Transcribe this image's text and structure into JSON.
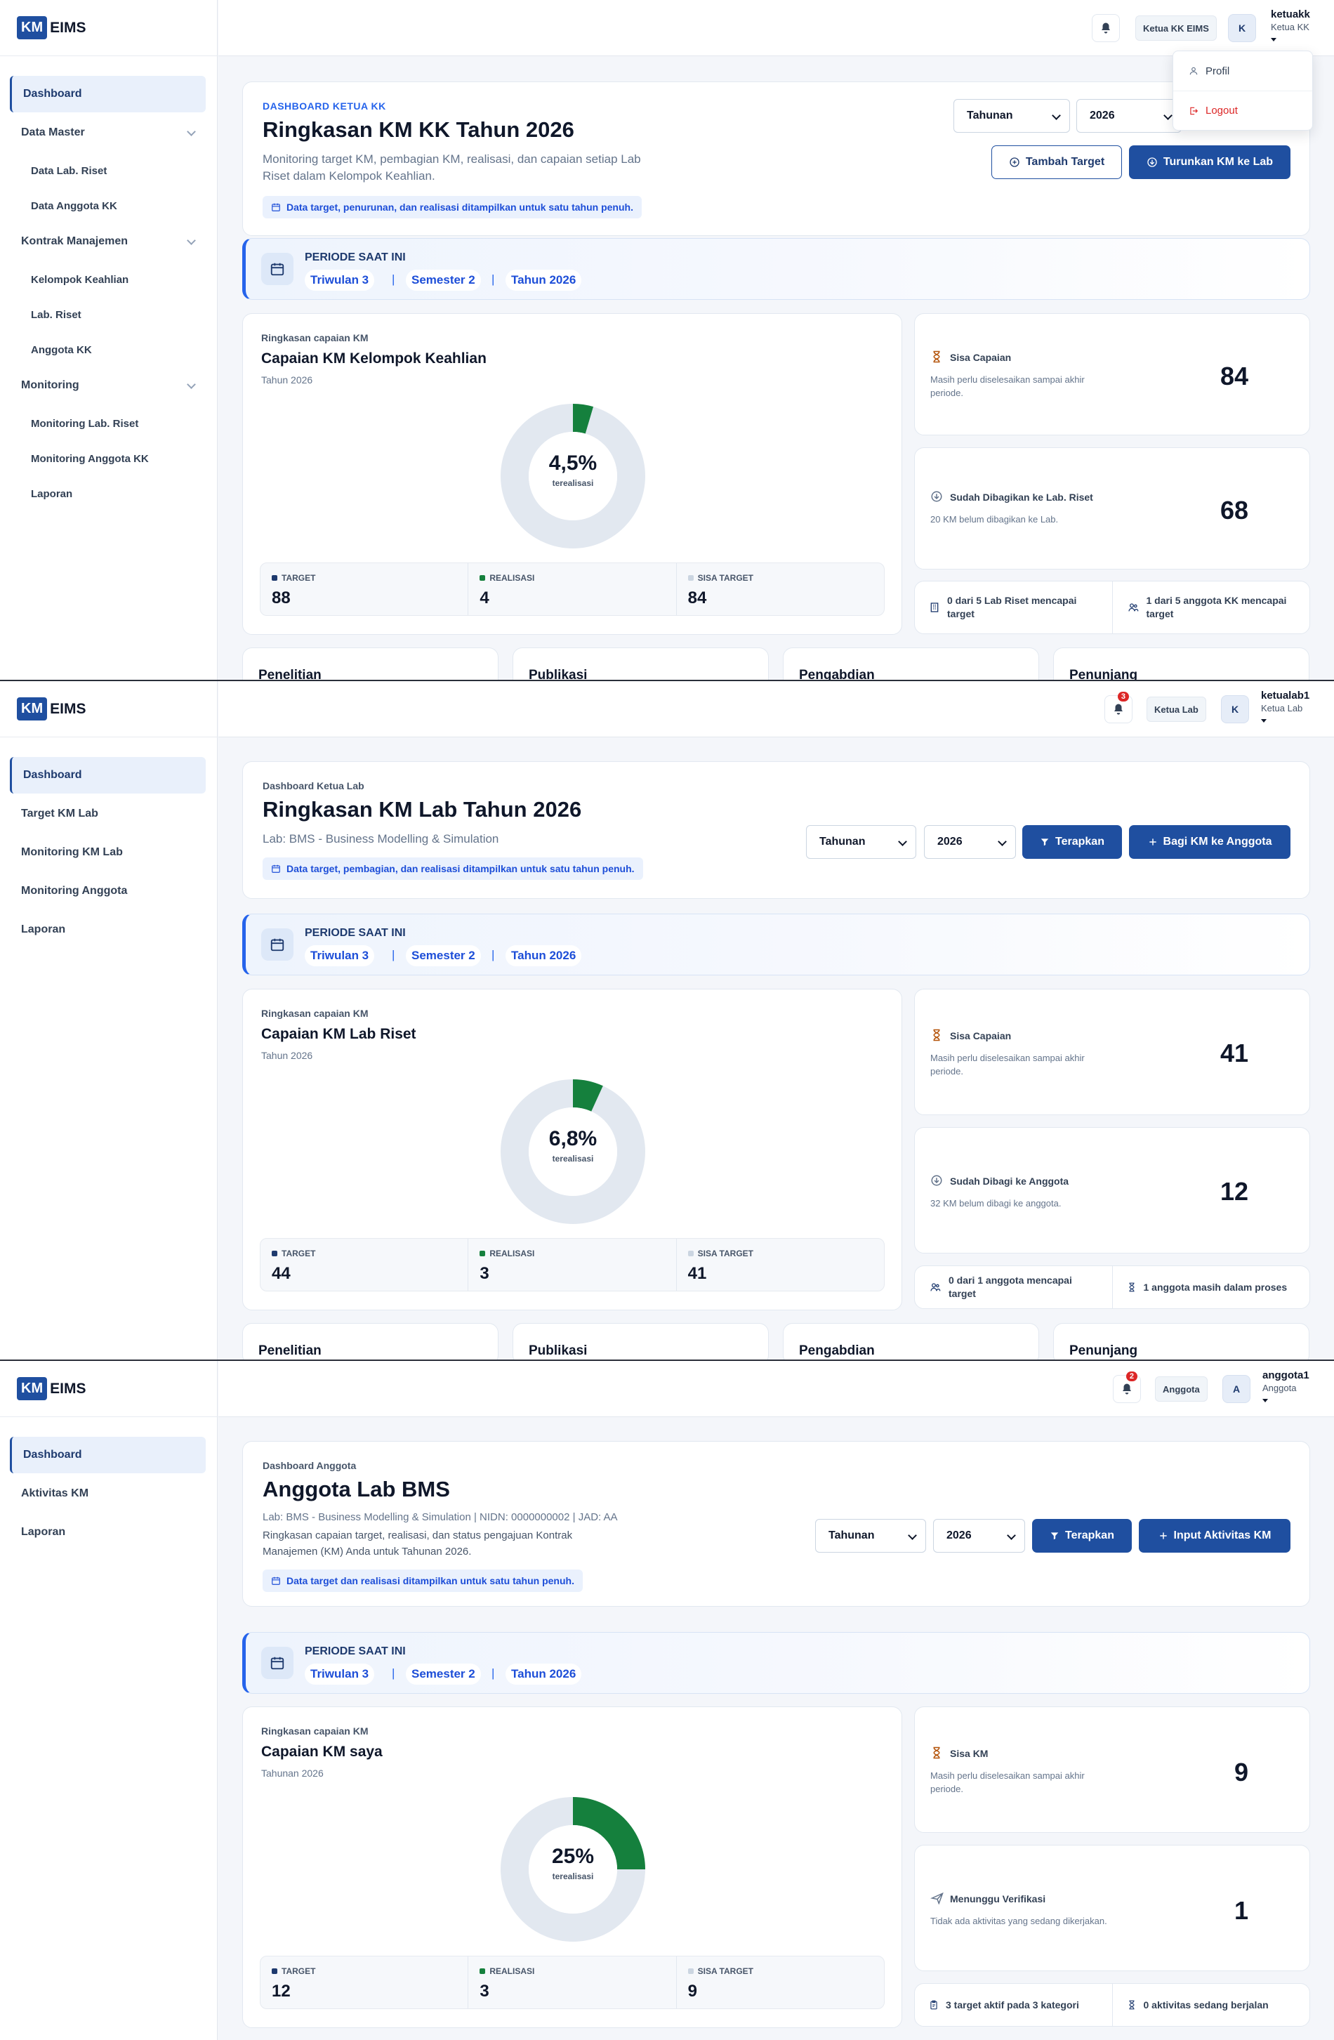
{
  "brand": {
    "km": "KM",
    "name": "EIMS"
  },
  "colors": {
    "primary": "#1f4fa0",
    "accent_blue": "#2563eb",
    "progress_green": "#15803d",
    "track": "#e2e8f0",
    "danger": "#dc2626"
  },
  "icons": {
    "bell": "bell-icon",
    "hourglass": "hourglass-icon",
    "download": "download-circle-icon",
    "calendar": "calendar-icon",
    "users": "users-icon",
    "building": "building-icon",
    "plane": "paper-plane-icon",
    "clipboard": "clipboard-icon",
    "filter": "filter-icon",
    "plus": "plus-icon",
    "profile": "user-icon",
    "logout": "logout-icon"
  },
  "panels": [
    {
      "sidebar": {
        "items": [
          {
            "label": "Dashboard",
            "active": true,
            "type": "item"
          },
          {
            "label": "Data Master",
            "type": "group"
          },
          {
            "label": "Data Lab. Riset",
            "type": "sub"
          },
          {
            "label": "Data Anggota KK",
            "type": "sub"
          },
          {
            "label": "Kontrak Manajemen",
            "type": "group"
          },
          {
            "label": "Kelompok Keahlian",
            "type": "sub"
          },
          {
            "label": "Lab. Riset",
            "type": "sub"
          },
          {
            "label": "Anggota KK",
            "type": "sub"
          },
          {
            "label": "Monitoring",
            "type": "group"
          },
          {
            "label": "Monitoring Lab. Riset",
            "type": "sub"
          },
          {
            "label": "Monitoring Anggota KK",
            "type": "sub"
          },
          {
            "label": "Laporan",
            "type": "sub"
          }
        ]
      },
      "topbar": {
        "badge": "",
        "role_chip": "Ketua KK EIMS",
        "avatar": "K",
        "user": "ketuakk",
        "user_role": "Ketua KK"
      },
      "dropdown": {
        "profile": "Profil",
        "logout": "Logout"
      },
      "header": {
        "eyebrow": "DASHBOARD KETUA KK",
        "title": "Ringkasan KM KK Tahun 2026",
        "desc": "Monitoring target KM, pembagian KM, realisasi, dan capaian setiap Lab Riset dalam Kelompok Keahlian.",
        "note": "Data target, penurunan, dan realisasi ditampilkan untuk satu tahun penuh.",
        "select_period": "Tahunan",
        "select_year": "2026",
        "btn_secondary": "Tambah Target",
        "btn_primary": "Turunkan KM ke Lab"
      },
      "period": {
        "label": "PERIODE SAAT INI",
        "triwulan": "Triwulan 3",
        "semester": "Semester 2",
        "tahun": "Tahun 2026"
      },
      "chart": {
        "eyebrow": "Ringkasan capaian KM",
        "title": "Capaian KM Kelompok Keahlian",
        "sub": "Tahun 2026",
        "pct": "4,5%",
        "cap": "terealisasi",
        "target_lbl": "TARGET",
        "target": "88",
        "real_lbl": "REALISASI",
        "real": "4",
        "sisa_lbl": "SISA TARGET",
        "sisa": "84"
      },
      "chart_data": {
        "type": "pie",
        "categories": [
          "Realisasi",
          "Sisa Target"
        ],
        "values": [
          4,
          84
        ],
        "percent_realized": 4.5
      },
      "side1": {
        "title": "Sisa Capaian",
        "desc": "Masih perlu diselesaikan sampai akhir periode.",
        "value": "84"
      },
      "side2": {
        "title": "Sudah Dibagikan ke Lab. Riset",
        "desc": "20 KM belum dibagikan ke Lab.",
        "value": "68"
      },
      "mini": [
        "0 dari 5 Lab Riset mencapai target",
        "1 dari 5 anggota KK mencapai target"
      ],
      "categories": [
        "Penelitian",
        "Publikasi",
        "Pengabdian",
        "Penunjang"
      ]
    },
    {
      "sidebar": {
        "items": [
          {
            "label": "Dashboard",
            "active": true,
            "type": "item"
          },
          {
            "label": "Target KM Lab",
            "type": "item"
          },
          {
            "label": "Monitoring KM Lab",
            "type": "item"
          },
          {
            "label": "Monitoring Anggota",
            "type": "item"
          },
          {
            "label": "Laporan",
            "type": "item"
          }
        ]
      },
      "topbar": {
        "badge": "3",
        "role_chip": "Ketua Lab",
        "avatar": "K",
        "user": "ketualab1",
        "user_role": "Ketua Lab"
      },
      "header": {
        "eyebrow": "Dashboard Ketua Lab",
        "title": "Ringkasan KM Lab Tahun 2026",
        "desc": "Lab: BMS - Business Modelling & Simulation",
        "note": "Data target, pembagian, dan realisasi ditampilkan untuk satu tahun penuh.",
        "select_period": "Tahunan",
        "select_year": "2026",
        "btn_filter": "Terapkan",
        "btn_primary": "Bagi KM ke Anggota"
      },
      "period": {
        "label": "PERIODE SAAT INI",
        "triwulan": "Triwulan 3",
        "semester": "Semester 2",
        "tahun": "Tahun 2026"
      },
      "chart": {
        "eyebrow": "Ringkasan capaian KM",
        "title": "Capaian KM Lab Riset",
        "sub": "Tahun 2026",
        "pct": "6,8%",
        "cap": "terealisasi",
        "target_lbl": "TARGET",
        "target": "44",
        "real_lbl": "REALISASI",
        "real": "3",
        "sisa_lbl": "SISA TARGET",
        "sisa": "41"
      },
      "chart_data": {
        "type": "pie",
        "categories": [
          "Realisasi",
          "Sisa Target"
        ],
        "values": [
          3,
          41
        ],
        "percent_realized": 6.8
      },
      "side1": {
        "title": "Sisa Capaian",
        "desc": "Masih perlu diselesaikan sampai akhir periode.",
        "value": "41"
      },
      "side2": {
        "title": "Sudah Dibagi ke Anggota",
        "desc": "32 KM belum dibagi ke anggota.",
        "value": "12"
      },
      "mini": [
        "0 dari 1 anggota mencapai target",
        "1 anggota masih dalam proses"
      ],
      "categories": [
        "Penelitian",
        "Publikasi",
        "Pengabdian",
        "Penunjang"
      ]
    },
    {
      "sidebar": {
        "items": [
          {
            "label": "Dashboard",
            "active": true,
            "type": "item"
          },
          {
            "label": "Aktivitas KM",
            "type": "item"
          },
          {
            "label": "Laporan",
            "type": "item"
          }
        ]
      },
      "topbar": {
        "badge": "2",
        "role_chip": "Anggota",
        "avatar": "A",
        "user": "anggota1",
        "user_role": "Anggota"
      },
      "header": {
        "eyebrow": "Dashboard Anggota",
        "title": "Anggota Lab BMS",
        "meta": "Lab: BMS - Business Modelling & Simulation | NIDN: 0000000002 | JAD: AA",
        "desc": "Ringkasan capaian target, realisasi, dan status pengajuan Kontrak Manajemen (KM) Anda untuk Tahunan 2026.",
        "note": "Data target dan realisasi ditampilkan untuk satu tahun penuh.",
        "select_period": "Tahunan",
        "select_year": "2026",
        "btn_filter": "Terapkan",
        "btn_primary": "Input Aktivitas KM"
      },
      "period": {
        "label": "PERIODE SAAT INI",
        "triwulan": "Triwulan 3",
        "semester": "Semester 2",
        "tahun": "Tahun 2026"
      },
      "chart": {
        "eyebrow": "Ringkasan capaian KM",
        "title": "Capaian KM saya",
        "sub": "Tahunan 2026",
        "pct": "25%",
        "cap": "terealisasi",
        "target_lbl": "TARGET",
        "target": "12",
        "real_lbl": "REALISASI",
        "real": "3",
        "sisa_lbl": "SISA TARGET",
        "sisa": "9"
      },
      "chart_data": {
        "type": "pie",
        "categories": [
          "Realisasi",
          "Sisa Target"
        ],
        "values": [
          3,
          9
        ],
        "percent_realized": 25
      },
      "side1": {
        "title": "Sisa KM",
        "desc": "Masih perlu diselesaikan sampai akhir periode.",
        "value": "9"
      },
      "side2": {
        "title": "Menunggu Verifikasi",
        "desc": "Tidak ada aktivitas yang sedang dikerjakan.",
        "value": "1"
      },
      "mini": [
        "3 target aktif pada 3 kategori",
        "0 aktivitas sedang berjalan"
      ]
    }
  ]
}
